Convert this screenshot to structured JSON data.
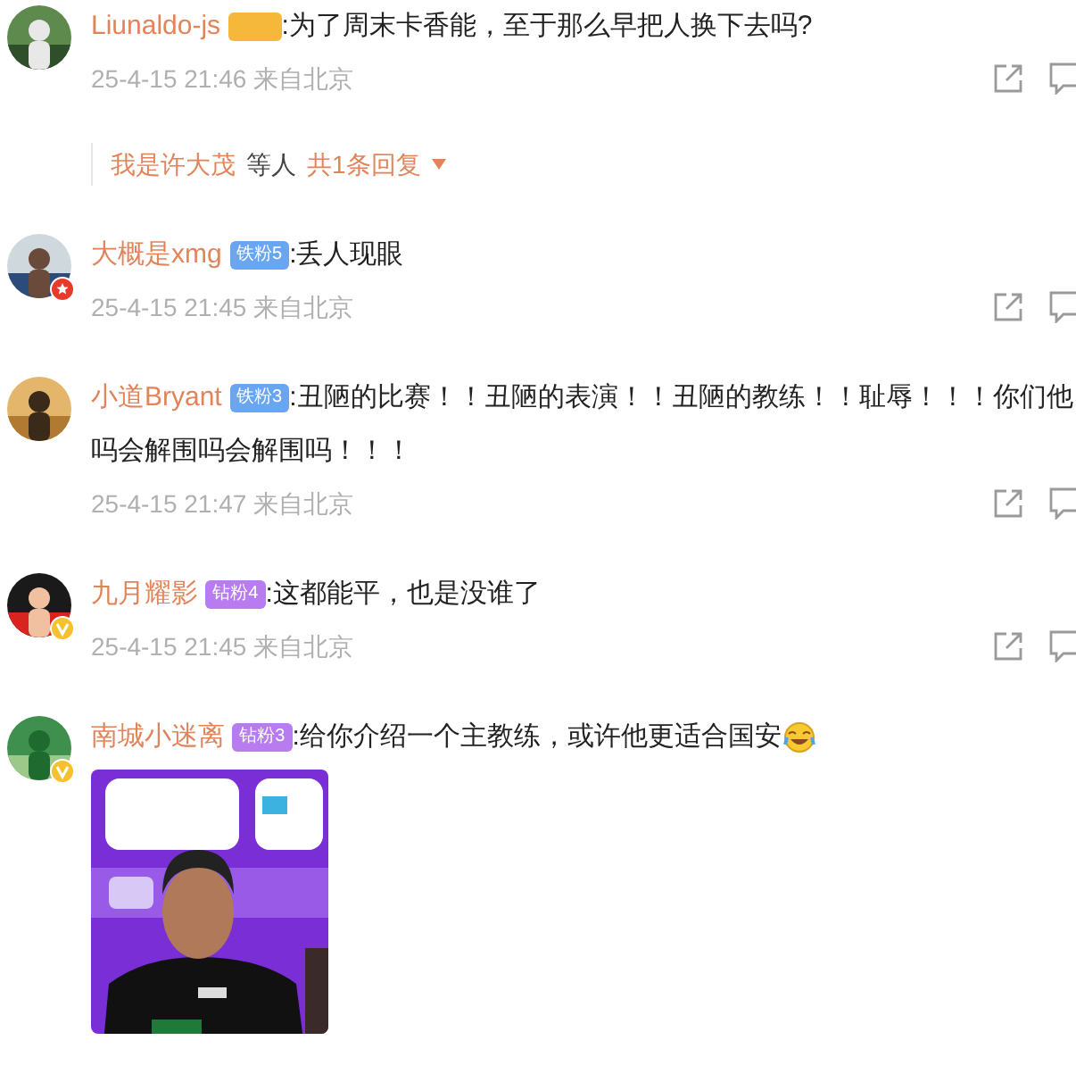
{
  "comments": [
    {
      "user": "Liunaldo-js",
      "badge": {
        "color": "#f5b83a"
      },
      "lines": [
        ":为了周末卡香能，至于那么早把人换下去吗?"
      ],
      "time": "25-4-15 21:46 来自北京",
      "replies": {
        "names": "我是许大茂",
        "suffix": "等人",
        "count": "共1条回复"
      }
    },
    {
      "user": "大概是xmg",
      "badge": {
        "label": "铁粉5",
        "color": "#6aa5ef"
      },
      "lines": [
        ":丢人现眼"
      ],
      "time": "25-4-15 21:45 来自北京",
      "avatar_badge": {
        "kind": "star"
      }
    },
    {
      "user": "小道Bryant",
      "badge": {
        "label": "铁粉3",
        "color": "#6aa5ef"
      },
      "lines": [
        ":丑陋的比赛！！丑陋的表演！！丑陋的教练！！耻辱！！！你们他",
        "吗会解围吗会解围吗！！！"
      ],
      "time": "25-4-15 21:47 来自北京"
    },
    {
      "user": "九月耀影",
      "badge": {
        "label": "钻粉4",
        "color": "#b77cf0"
      },
      "lines": [
        ":这都能平，也是没谁了"
      ],
      "time": "25-4-15 21:45 来自北京",
      "avatar_badge": {
        "kind": "verified"
      }
    },
    {
      "user": "南城小迷离",
      "badge": {
        "label": "钻粉3",
        "color": "#b77cf0"
      },
      "lines": [
        ":给你介绍一个主教练，或许他更适合国安"
      ],
      "avatar_badge": {
        "kind": "verified"
      },
      "emoji": true,
      "image": {
        "kind": "picture"
      }
    }
  ]
}
